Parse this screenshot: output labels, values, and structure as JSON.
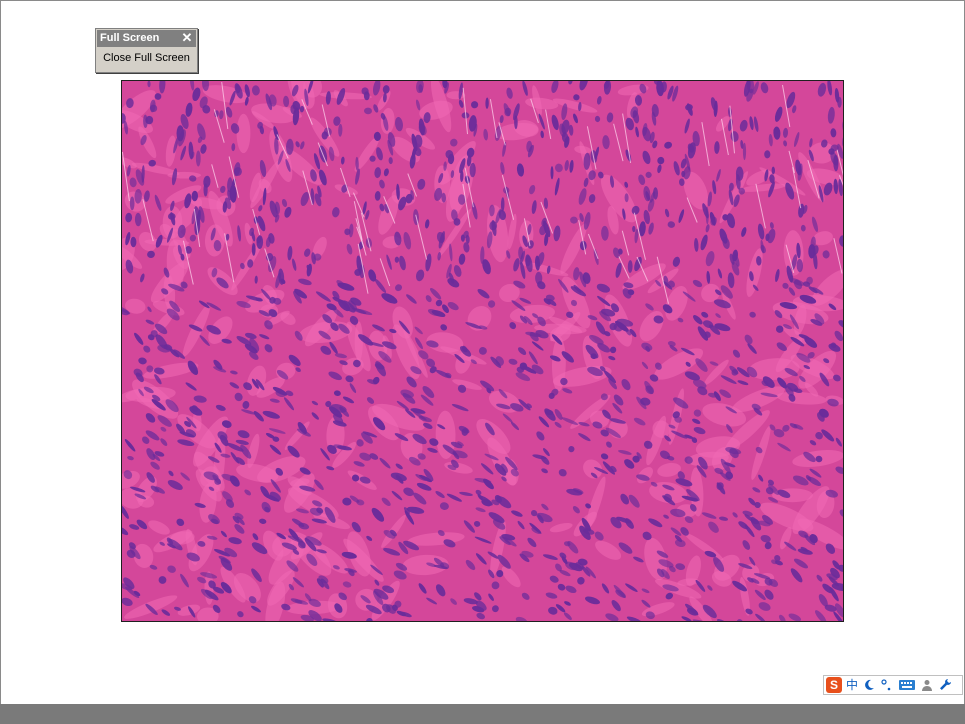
{
  "fullscreen_toolbar": {
    "title": "Full Screen",
    "close_symbol": "✕",
    "button_label": "Close Full Screen"
  },
  "main_image": {
    "description_icon": "micrograph-image",
    "colors": {
      "stroma": "#d4479a",
      "nuclei": "#6a2c9a",
      "highlight": "#f06ab4"
    }
  },
  "ime_bar": {
    "logo": "S",
    "mode": "中",
    "icons": [
      "moon-icon",
      "punctuation-icon",
      "keyboard-icon",
      "user-icon",
      "wrench-icon"
    ]
  }
}
